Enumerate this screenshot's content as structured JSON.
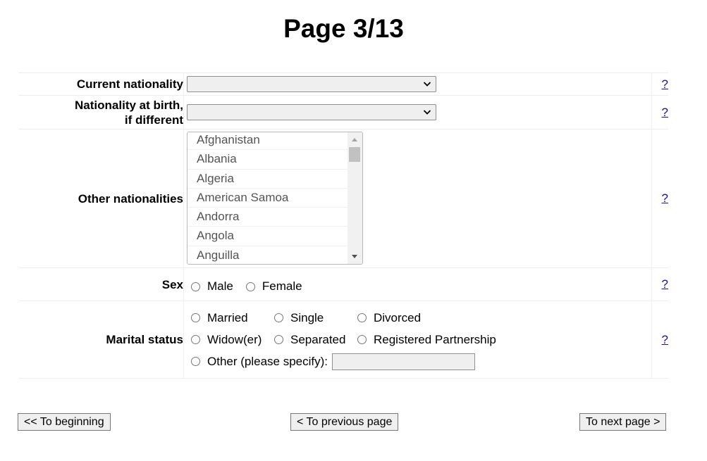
{
  "page": {
    "title": "Page 3/13"
  },
  "form": {
    "current_nationality": {
      "label": "Current nationality",
      "value": "",
      "help": "?"
    },
    "nationality_at_birth": {
      "label_line1": "Nationality at birth,",
      "label_line2": "if different",
      "value": "",
      "help": "?"
    },
    "other_nationalities": {
      "label": "Other nationalities",
      "options": [
        "Afghanistan",
        "Albania",
        "Algeria",
        "American Samoa",
        "Andorra",
        "Angola",
        "Anguilla"
      ],
      "help": "?"
    },
    "sex": {
      "label": "Sex",
      "options": [
        "Male",
        "Female"
      ],
      "help": "?"
    },
    "marital_status": {
      "label": "Marital status",
      "options_row1": [
        "Married",
        "Single",
        "Divorced"
      ],
      "options_row2": [
        "Widow(er)",
        "Separated",
        "Registered Partnership"
      ],
      "other_label": "Other (please specify):",
      "other_value": "",
      "help": "?"
    }
  },
  "navigation": {
    "beginning": "<< To beginning",
    "previous": "< To previous page",
    "next": "To next page >"
  }
}
